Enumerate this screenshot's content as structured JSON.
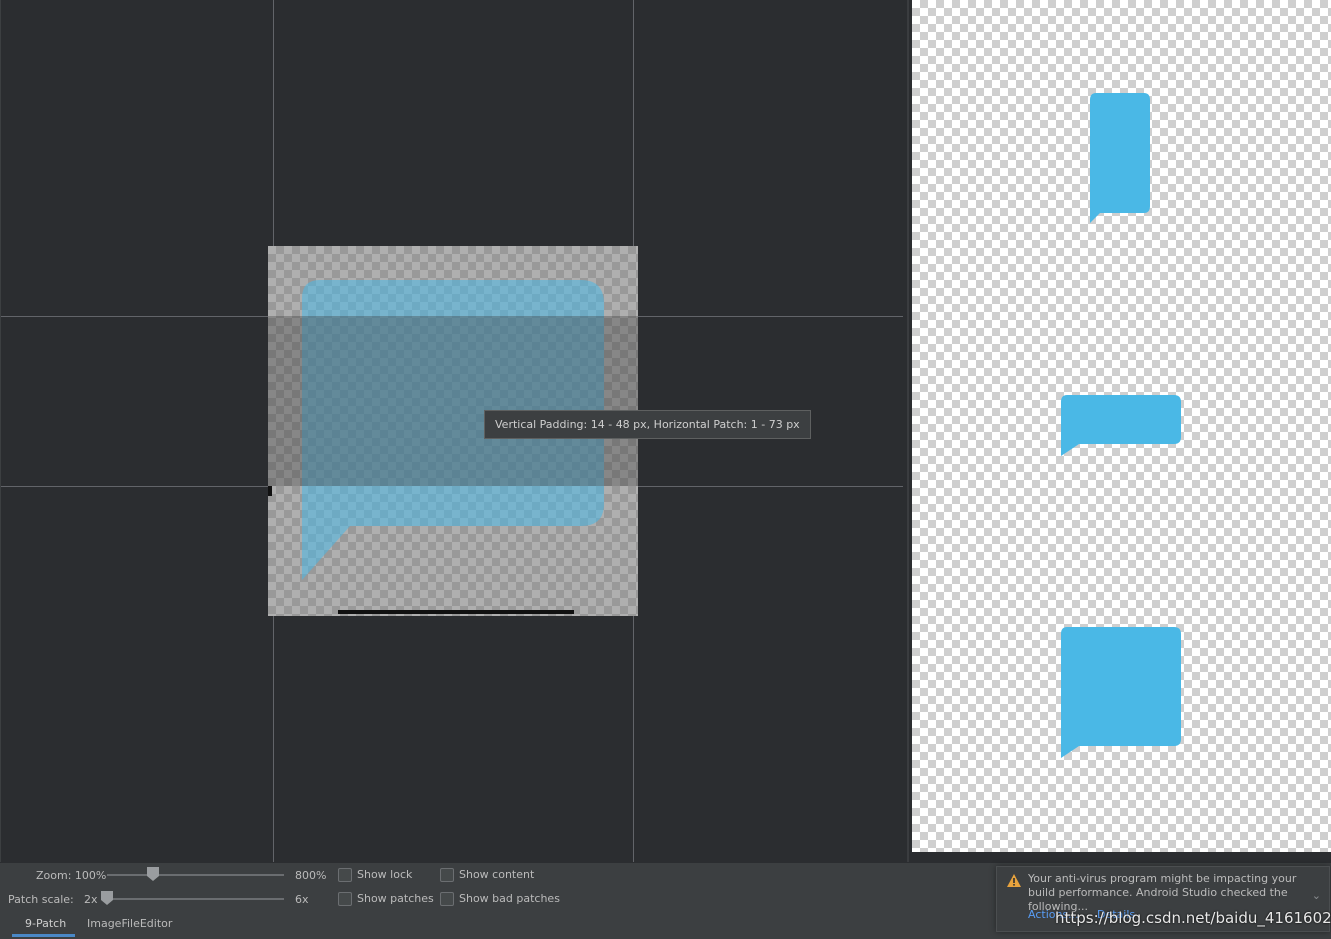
{
  "tooltip": {
    "text": "Vertical Padding: 14 - 48 px, Horizontal Patch: 1 - 73 px"
  },
  "controls": {
    "zoom_label": "Zoom: 100%",
    "zoom_max": "800%",
    "patch_scale_label": "Patch scale:",
    "patch_scale_min": "2x",
    "patch_scale_max": "6x",
    "show_lock": "Show lock",
    "show_content": "Show content",
    "show_patches": "Show patches",
    "show_bad_patches": "Show bad patches"
  },
  "tabs": [
    {
      "label": "9-Patch",
      "active": true
    },
    {
      "label": "ImageFileEditor",
      "active": false
    }
  ],
  "notification": {
    "message": "Your anti-virus program might be impacting your build performance. Android Studio checked the following...",
    "action_1": "Actions...",
    "action_2": "Details",
    "icon": "warning-icon"
  },
  "watermark": "https://blog.csdn.net/baidu_41616022",
  "colors": {
    "bubble": "#4ab8e6",
    "editor_bg": "#2b2d30",
    "panel_bg": "#3c3f41",
    "accent": "#4a88c7"
  }
}
